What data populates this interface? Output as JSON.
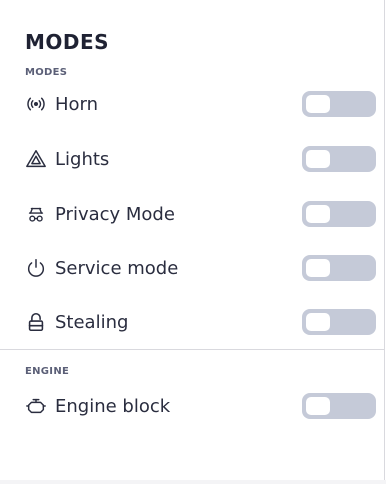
{
  "header": {
    "title": "MODES"
  },
  "sections": {
    "modes": {
      "label": "MODES",
      "items": [
        {
          "label": "Horn",
          "icon": "horn-icon",
          "enabled": false
        },
        {
          "label": "Lights",
          "icon": "warning-triangle-icon",
          "enabled": false
        },
        {
          "label": "Privacy Mode",
          "icon": "privacy-icon",
          "enabled": false
        },
        {
          "label": "Service mode",
          "icon": "power-icon",
          "enabled": false
        },
        {
          "label": "Stealing",
          "icon": "lock-icon",
          "enabled": false
        }
      ]
    },
    "engine": {
      "label": "ENGINE",
      "items": [
        {
          "label": "Engine block",
          "icon": "engine-icon",
          "enabled": false
        }
      ]
    }
  },
  "colors": {
    "text": "#2a2d3f",
    "section_label": "#5b5f77",
    "toggle_off": "#c5cad8",
    "divider": "#d9d9de"
  }
}
